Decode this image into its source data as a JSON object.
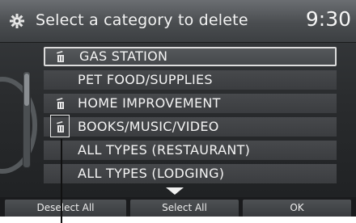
{
  "header": {
    "title": "Select a category to delete",
    "time": "9:30",
    "icon": "gear-icon"
  },
  "list": {
    "items": [
      {
        "label": "GAS STATION",
        "has_icon": true,
        "selected": true
      },
      {
        "label": "PET FOOD/SUPPLIES",
        "has_icon": false,
        "selected": false
      },
      {
        "label": "HOME IMPROVEMENT",
        "has_icon": true,
        "selected": false
      },
      {
        "label": "BOOKS/MUSIC/VIDEO",
        "has_icon": true,
        "selected": false,
        "callout": true
      },
      {
        "label": "ALL TYPES (RESTAURANT)",
        "has_icon": false,
        "selected": false
      },
      {
        "label": "ALL TYPES (LODGING)",
        "has_icon": false,
        "selected": false
      }
    ],
    "item_icon": "trash-can-icon"
  },
  "footer": {
    "deselect_all_label": "Deselect All",
    "select_all_label": "Select All",
    "ok_label": "OK"
  },
  "colors": {
    "background": "#2a2c2e",
    "header": "#4a4d50",
    "text": "#f4f4f4",
    "selected_border": "#dcdcdc"
  }
}
